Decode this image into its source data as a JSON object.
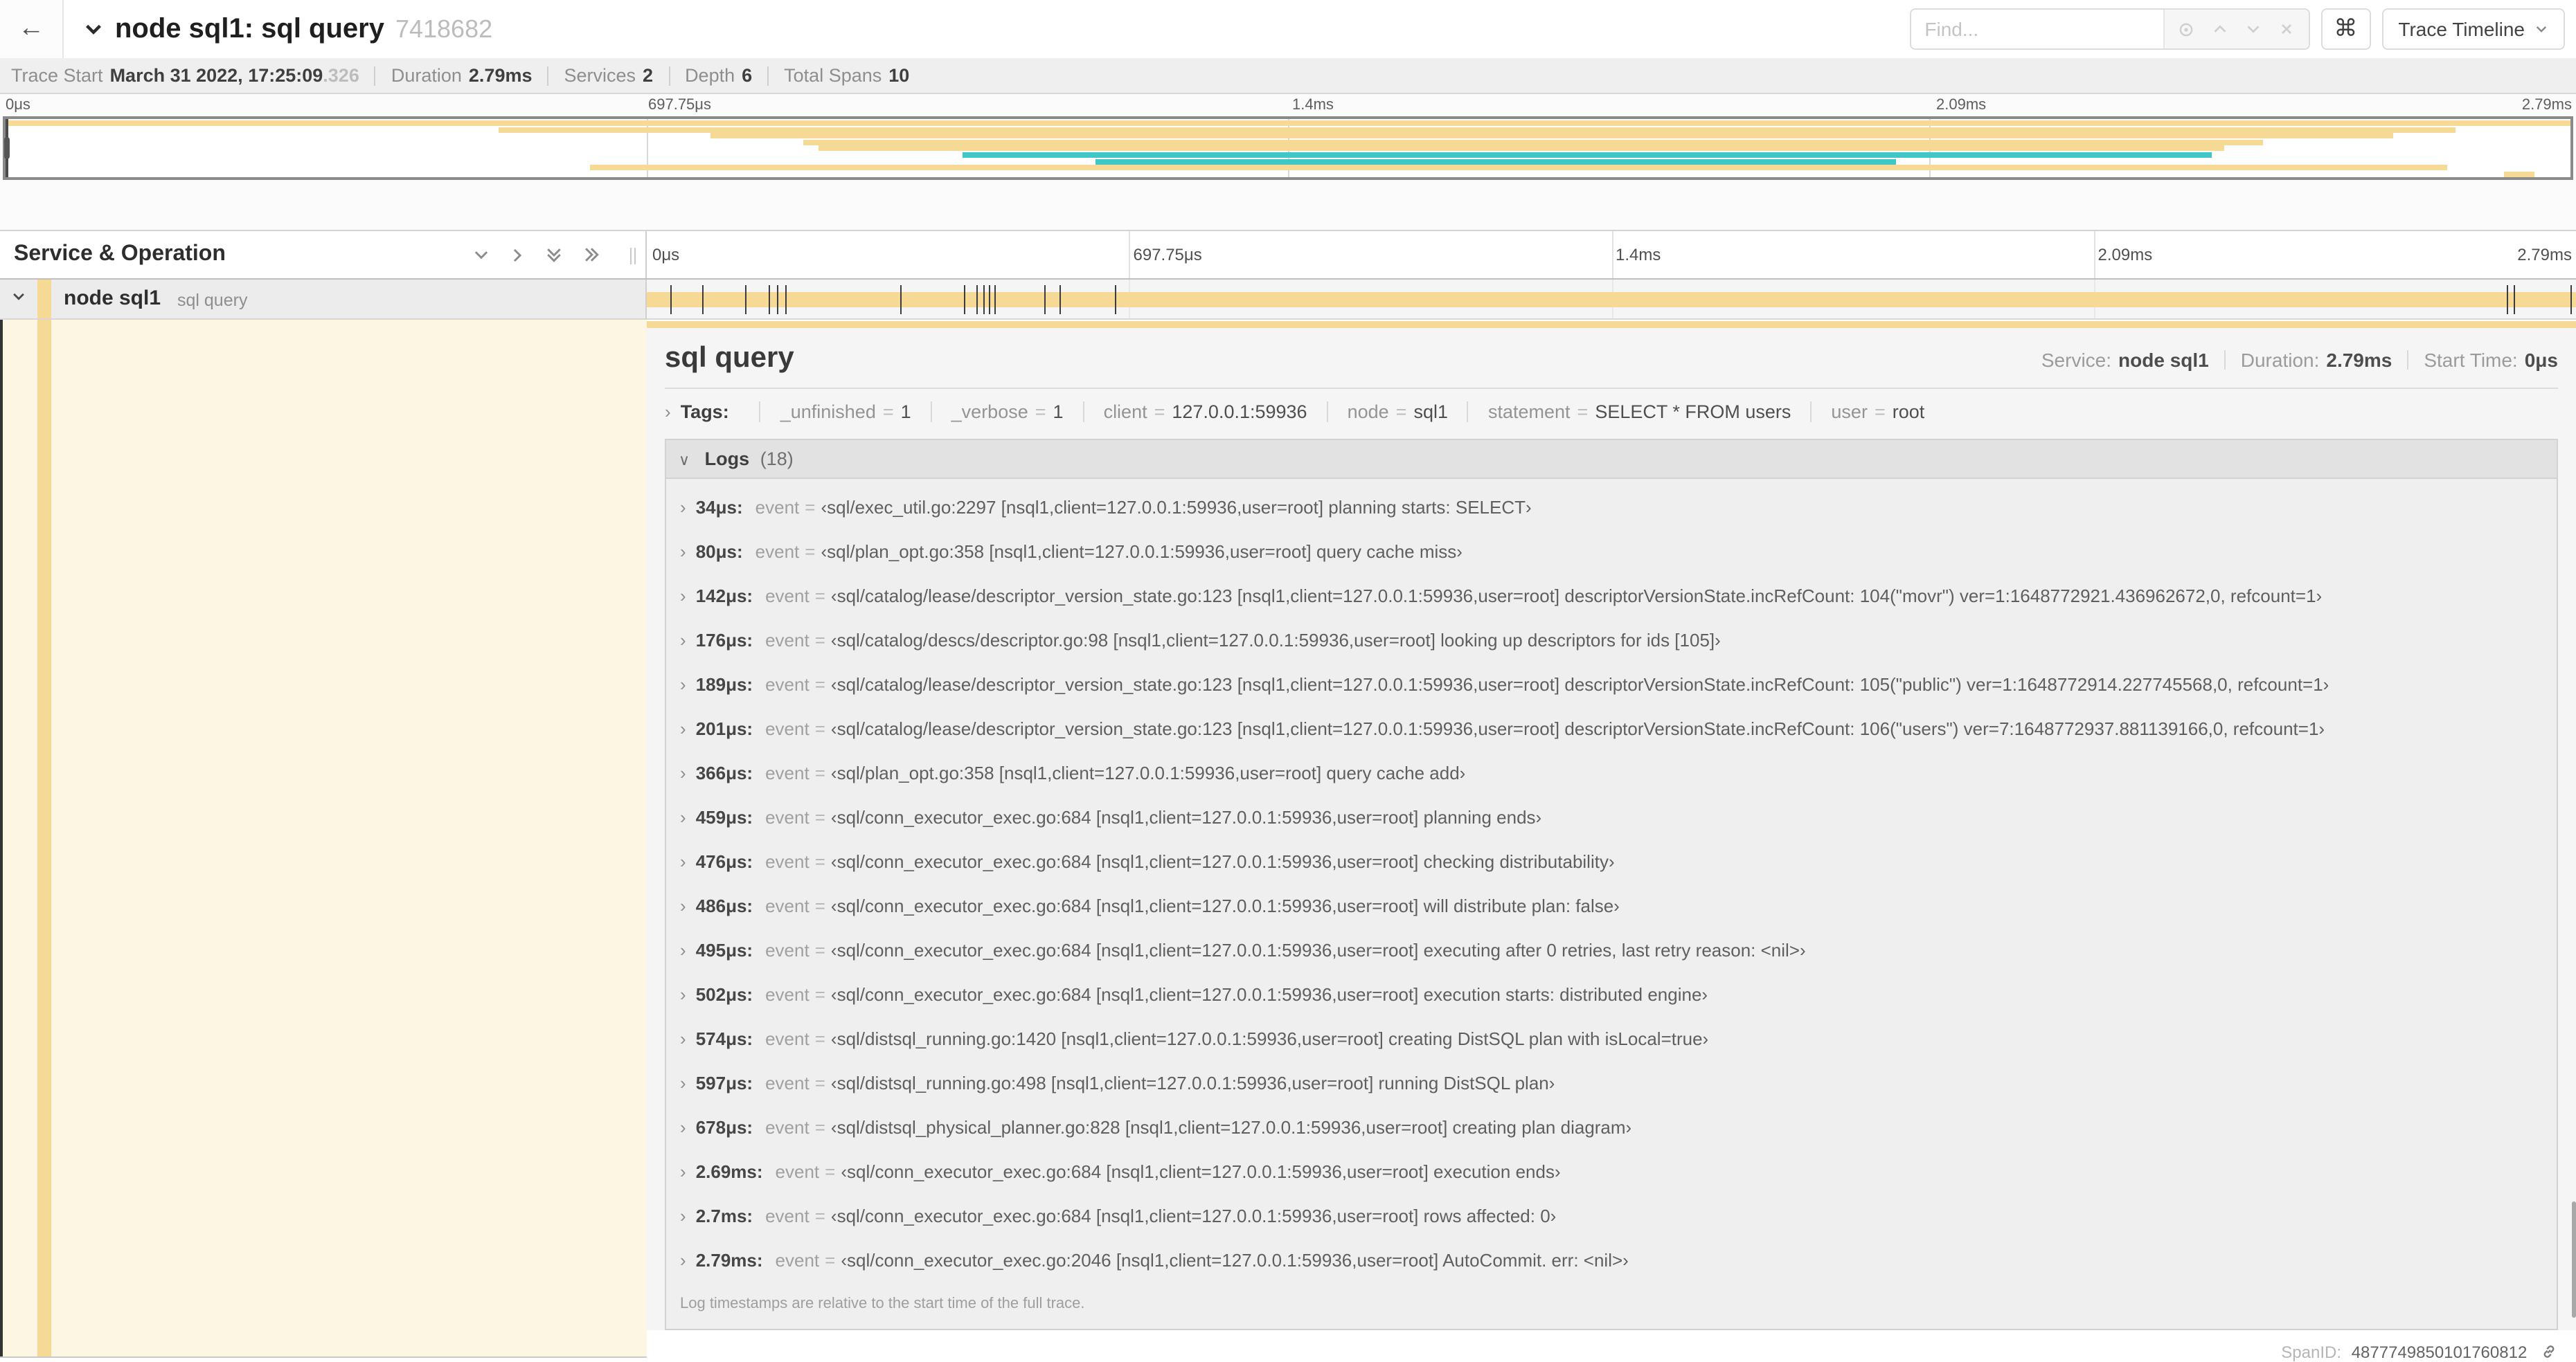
{
  "topbar": {
    "back_icon": "←",
    "title": "node sql1: sql query",
    "trace_id": "7418682",
    "find_placeholder": "Find...",
    "command_icon": "⌘",
    "view_button": "Trace Timeline"
  },
  "summary": {
    "trace_start_label": "Trace Start",
    "trace_start_value": "March 31 2022, 17:25:09",
    "trace_start_ms": ".326",
    "duration_label": "Duration",
    "duration_value": "2.79ms",
    "services_label": "Services",
    "services_value": "2",
    "depth_label": "Depth",
    "depth_value": "6",
    "spans_label": "Total Spans",
    "spans_value": "10"
  },
  "timeline": {
    "ticks": [
      "0μs",
      "697.75μs",
      "1.4ms",
      "2.09ms",
      "2.79ms"
    ],
    "span_color": "#f6d995",
    "teal_color": "#3fc6c6",
    "minimap_rows": [
      {
        "s": 0,
        "e": 100,
        "c": "tan"
      },
      {
        "s": 19.2,
        "e": 95.5,
        "c": "tan"
      },
      {
        "s": 27.5,
        "e": 93.1,
        "c": "tan"
      },
      {
        "s": 31.1,
        "e": 88.0,
        "c": "tan"
      },
      {
        "s": 31.7,
        "e": 86.5,
        "c": "tan"
      },
      {
        "s": 37.3,
        "e": 86.0,
        "c": "teal"
      },
      {
        "s": 42.5,
        "e": 73.7,
        "c": "teal"
      },
      {
        "s": 22.8,
        "e": 95.2,
        "c": "tan"
      },
      {
        "s": 97.4,
        "e": 98.6,
        "c": "tan"
      }
    ]
  },
  "tree": {
    "header": "Service & Operation",
    "service": "node sql1",
    "operation": "sql query"
  },
  "detail": {
    "title": "sql query",
    "service_label": "Service:",
    "service": "node sql1",
    "duration_label": "Duration:",
    "duration": "2.79ms",
    "start_label": "Start Time:",
    "start": "0μs",
    "tags_chevron": "›",
    "tags_label": "Tags:",
    "tags": [
      {
        "key": "_unfinished",
        "value": "1"
      },
      {
        "key": "_verbose",
        "value": "1"
      },
      {
        "key": "client",
        "value": "127.0.0.1:59936"
      },
      {
        "key": "node",
        "value": "sql1"
      },
      {
        "key": "statement",
        "value": "SELECT * FROM users"
      },
      {
        "key": "user",
        "value": "root"
      }
    ],
    "logs_chevron": "∨",
    "logs_label": "Logs",
    "logs_count": "(18)",
    "row_chevron": "›",
    "field_label": "event",
    "eq": "=",
    "logs": [
      {
        "time": "34μs:",
        "pct": 1.22,
        "msg": "‹sql/exec_util.go:2297 [nsql1,client=127.0.0.1:59936,user=root] planning starts: SELECT›"
      },
      {
        "time": "80μs:",
        "pct": 2.87,
        "msg": "‹sql/plan_opt.go:358 [nsql1,client=127.0.0.1:59936,user=root] query cache miss›"
      },
      {
        "time": "142μs:",
        "pct": 5.09,
        "msg": "‹sql/catalog/lease/descriptor_version_state.go:123 [nsql1,client=127.0.0.1:59936,user=root] descriptorVersionState.incRefCount: 104(\"movr\") ver=1:1648772921.436962672,0, refcount=1›"
      },
      {
        "time": "176μs:",
        "pct": 6.31,
        "msg": "‹sql/catalog/descs/descriptor.go:98 [nsql1,client=127.0.0.1:59936,user=root] looking up descriptors for ids [105]›"
      },
      {
        "time": "189μs:",
        "pct": 6.77,
        "msg": "‹sql/catalog/lease/descriptor_version_state.go:123 [nsql1,client=127.0.0.1:59936,user=root] descriptorVersionState.incRefCount: 105(\"public\") ver=1:1648772914.227745568,0, refcount=1›"
      },
      {
        "time": "201μs:",
        "pct": 7.2,
        "msg": "‹sql/catalog/lease/descriptor_version_state.go:123 [nsql1,client=127.0.0.1:59936,user=root] descriptorVersionState.incRefCount: 106(\"users\") ver=7:1648772937.881139166,0, refcount=1›"
      },
      {
        "time": "366μs:",
        "pct": 13.12,
        "msg": "‹sql/plan_opt.go:358 [nsql1,client=127.0.0.1:59936,user=root] query cache add›"
      },
      {
        "time": "459μs:",
        "pct": 16.45,
        "msg": "‹sql/conn_executor_exec.go:684 [nsql1,client=127.0.0.1:59936,user=root] planning ends›"
      },
      {
        "time": "476μs:",
        "pct": 17.06,
        "msg": "‹sql/conn_executor_exec.go:684 [nsql1,client=127.0.0.1:59936,user=root] checking distributability›"
      },
      {
        "time": "486μs:",
        "pct": 17.42,
        "msg": "‹sql/conn_executor_exec.go:684 [nsql1,client=127.0.0.1:59936,user=root] will distribute plan: false›"
      },
      {
        "time": "495μs:",
        "pct": 17.74,
        "msg": "‹sql/conn_executor_exec.go:684 [nsql1,client=127.0.0.1:59936,user=root] executing after 0 retries, last retry reason: <nil>›"
      },
      {
        "time": "502μs:",
        "pct": 17.99,
        "msg": "‹sql/conn_executor_exec.go:684 [nsql1,client=127.0.0.1:59936,user=root] execution starts: distributed engine›"
      },
      {
        "time": "574μs:",
        "pct": 20.57,
        "msg": "‹sql/distsql_running.go:1420 [nsql1,client=127.0.0.1:59936,user=root] creating DistSQL plan with isLocal=true›"
      },
      {
        "time": "597μs:",
        "pct": 21.4,
        "msg": "‹sql/distsql_running.go:498 [nsql1,client=127.0.0.1:59936,user=root] running DistSQL plan›"
      },
      {
        "time": "678μs:",
        "pct": 24.3,
        "msg": "‹sql/distsql_physical_planner.go:828 [nsql1,client=127.0.0.1:59936,user=root] creating plan diagram›"
      },
      {
        "time": "2.69ms:",
        "pct": 96.42,
        "msg": "‹sql/conn_executor_exec.go:684 [nsql1,client=127.0.0.1:59936,user=root] execution ends›"
      },
      {
        "time": "2.7ms:",
        "pct": 96.77,
        "msg": "‹sql/conn_executor_exec.go:684 [nsql1,client=127.0.0.1:59936,user=root] rows affected: 0›"
      },
      {
        "time": "2.79ms:",
        "pct": 99.7,
        "msg": "‹sql/conn_executor_exec.go:2046 [nsql1,client=127.0.0.1:59936,user=root] AutoCommit. err: <nil>›"
      }
    ],
    "note": "Log timestamps are relative to the start time of the full trace.",
    "spanid_label": "SpanID:",
    "spanid": "4877749850101760812"
  }
}
